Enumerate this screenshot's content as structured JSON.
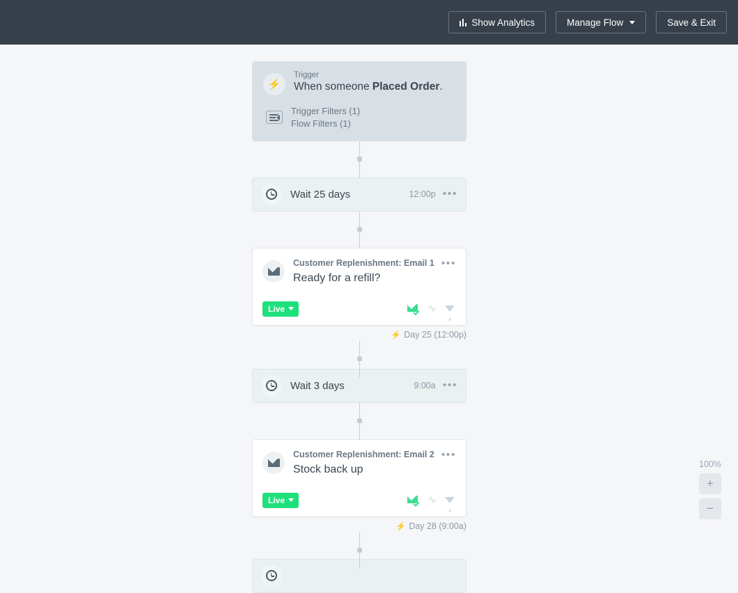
{
  "header": {
    "analytics_label": "Show Analytics",
    "manage_flow_label": "Manage Flow",
    "save_exit_label": "Save & Exit"
  },
  "flow": {
    "trigger": {
      "label": "Trigger",
      "text_prefix": "When someone ",
      "event": "Placed Order",
      "text_suffix": ".",
      "trigger_filters": "Trigger Filters (1)",
      "flow_filters": "Flow Filters (1)"
    },
    "steps": [
      {
        "type": "wait",
        "title": "Wait 25 days",
        "time": "12:00p",
        "menu": "•••"
      },
      {
        "type": "email",
        "name": "Customer Replenishment: Email 1",
        "subject": "Ready for a refill?",
        "status": "Live",
        "menu": "•••",
        "annotation": "Day 25 (12:00p)"
      },
      {
        "type": "wait",
        "title": "Wait 3 days",
        "time": "9:00a",
        "menu": "•••"
      },
      {
        "type": "email",
        "name": "Customer Replenishment: Email 2",
        "subject": "Stock back up",
        "status": "Live",
        "menu": "•••",
        "annotation": "Day 28 (9:00a)"
      }
    ]
  },
  "zoom": {
    "level": "100%",
    "zoom_in": "+",
    "zoom_out": "−"
  },
  "colors": {
    "header_bg": "#363f4a",
    "canvas_bg": "#f5f6f8",
    "trigger_bg": "#d8dfe5",
    "wait_bg": "#e9f1f1",
    "live_green": "#1ee07d",
    "icon_green": "#3ddc91",
    "muted_text": "#8b98a4"
  }
}
